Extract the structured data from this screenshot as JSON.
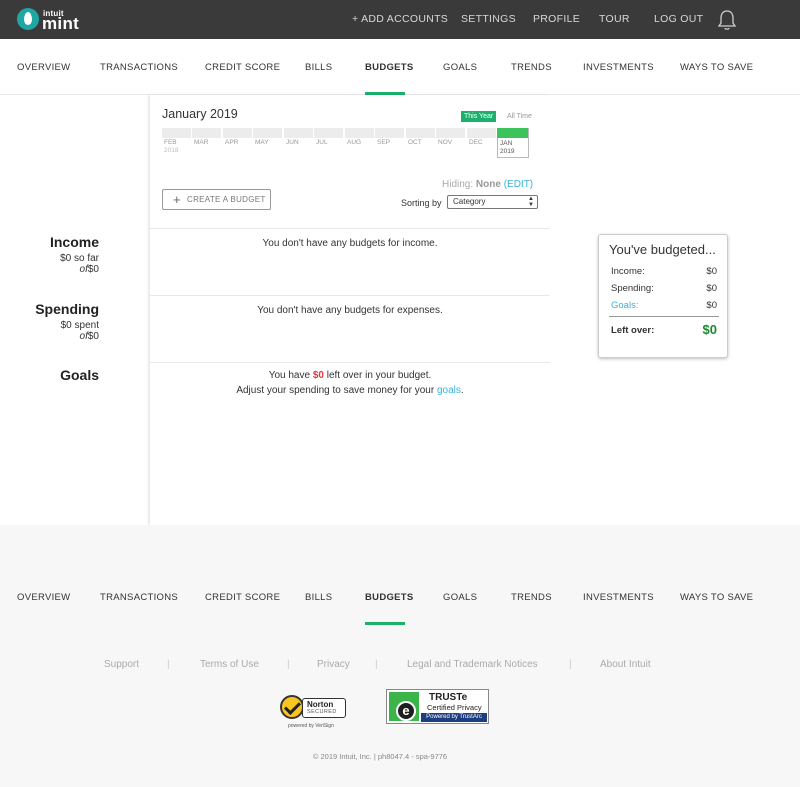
{
  "header": {
    "logo_small": "intuit",
    "logo_big": "mint",
    "links": [
      "+ ADD ACCOUNTS",
      "SETTINGS",
      "PROFILE",
      "TOUR",
      "LOG OUT"
    ]
  },
  "nav": {
    "items": [
      "OVERVIEW",
      "TRANSACTIONS",
      "CREDIT SCORE",
      "BILLS",
      "BUDGETS",
      "GOALS",
      "TRENDS",
      "INVESTMENTS",
      "WAYS TO SAVE"
    ],
    "active": "BUDGETS"
  },
  "period": {
    "title": "January 2019",
    "this_year_label": "This Year",
    "all_time_label": "All Time",
    "months": [
      {
        "label": "FEB",
        "year": "2018"
      },
      {
        "label": "MAR",
        "year": ""
      },
      {
        "label": "APR",
        "year": ""
      },
      {
        "label": "MAY",
        "year": ""
      },
      {
        "label": "JUN",
        "year": ""
      },
      {
        "label": "JUL",
        "year": ""
      },
      {
        "label": "AUG",
        "year": ""
      },
      {
        "label": "SEP",
        "year": ""
      },
      {
        "label": "OCT",
        "year": ""
      },
      {
        "label": "NOV",
        "year": ""
      },
      {
        "label": "DEC",
        "year": ""
      },
      {
        "label": "JAN",
        "year": "2019"
      }
    ]
  },
  "toolbar": {
    "create_label": "CREATE A BUDGET",
    "hiding_label": "Hiding:",
    "hiding_value": "None",
    "edit_label": "(EDIT)",
    "sorting_label": "Sorting by",
    "sort_value": "Category"
  },
  "income": {
    "title": "Income",
    "line1": "$0 so far",
    "of_label": "of",
    "of_value": "$0",
    "message": "You don't have any budgets for income."
  },
  "spending": {
    "title": "Spending",
    "line1": "$0 spent",
    "of_label": "of",
    "of_value": "$0",
    "message": "You don't have any budgets for expenses."
  },
  "goals": {
    "title": "Goals",
    "msg_pre": "You have ",
    "msg_amount": "$0",
    "msg_post": " left over in your budget.",
    "msg2_pre": "Adjust your spending to save money for your ",
    "msg2_link": "goals",
    "msg2_post": "."
  },
  "summary": {
    "title": "You've budgeted...",
    "income_label": "Income:",
    "income_value": "$0",
    "spending_label": "Spending:",
    "spending_value": "$0",
    "goals_label": "Goals:",
    "goals_value": "$0",
    "leftover_label": "Left over:",
    "leftover_value": "$0"
  },
  "footer": {
    "links": [
      "Support",
      "Terms of Use",
      "Privacy",
      "Legal and Trademark Notices",
      "About Intuit"
    ],
    "norton_name": "Norton",
    "norton_secured": "SECURED",
    "norton_powered": "powered by VeriSign",
    "truste_title": "TRUSTe",
    "truste_sub": "Certified Privacy",
    "truste_powered": "Powered by TrustArc",
    "copyright": "© 2019 Intuit, Inc.  |  ph8047.4 - spa-9776"
  },
  "colors": {
    "accent_green": "#1ab26b",
    "link_blue": "#3ab1dd",
    "alert_red": "#e8373c",
    "topbar": "#3a3a3a"
  }
}
